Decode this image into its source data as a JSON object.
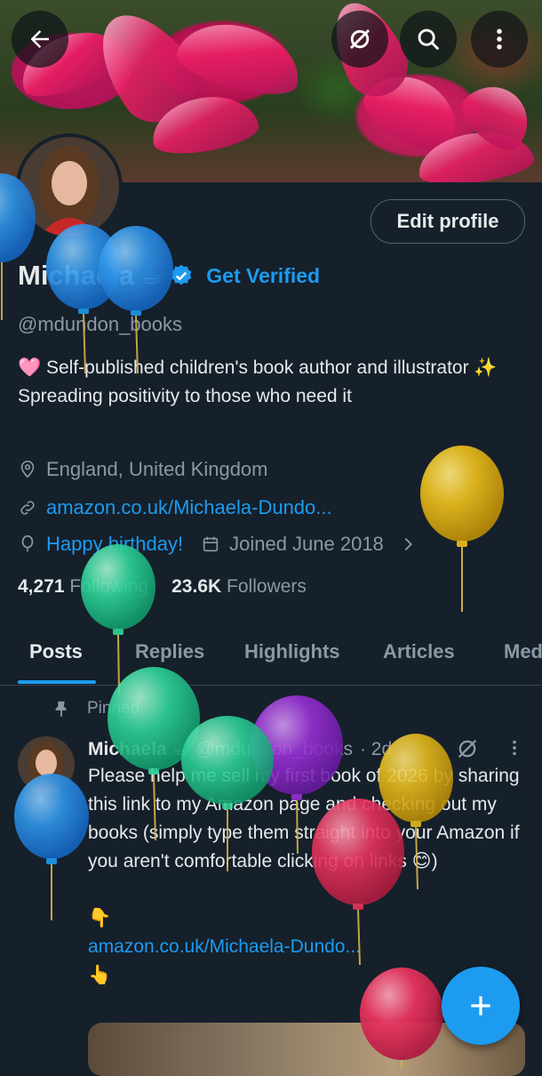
{
  "profile": {
    "name": "Michaela",
    "name_emoji": "☕",
    "get_verified": "Get Verified",
    "handle": "@mdundon_books",
    "edit_profile": "Edit profile",
    "bio": "🩷 Self-published children's book author and illustrator ✨ Spreading positivity to those who need it",
    "location": "England, United Kingdom",
    "website": "amazon.co.uk/Michaela-Dundo...",
    "birthday": "Happy birthday!",
    "joined": "Joined June 2018",
    "following_count": "4,271",
    "following_label": "Following",
    "followers_count": "23.6K",
    "followers_label": "Followers"
  },
  "tabs": [
    {
      "label": "Posts",
      "active": true
    },
    {
      "label": "Replies"
    },
    {
      "label": "Highlights"
    },
    {
      "label": "Articles"
    },
    {
      "label": "Med"
    }
  ],
  "pinned_post": {
    "pinned_label": "Pinned",
    "author": "Michaela ☕",
    "handle": "@mdundon_books",
    "time": "· 2d",
    "text": "Please help me sell my first book of 2026 by sharing this link to my Amazon page and checking out my books (simply type them straight into your Amazon if you aren't comfortable clicking on links 😊)",
    "pointer_down": "👇",
    "link": "amazon.co.uk/Michaela-Dundo...",
    "pointer_up": "👆"
  },
  "colors": {
    "background": "#15202b",
    "accent": "#1d9bf0",
    "muted": "#8b98a5",
    "balloon_blue": "#2f95e8",
    "balloon_green": "#2fd49a",
    "balloon_yellow": "#e4b91c",
    "balloon_purple": "#9b30d9",
    "balloon_pink": "#e8345e"
  },
  "icons": [
    "back-arrow-icon",
    "grok-icon",
    "search-icon",
    "more-vertical-icon",
    "verified-badge-icon",
    "location-icon",
    "link-icon",
    "birthday-balloon-icon",
    "calendar-icon",
    "chevron-right-icon",
    "pin-icon",
    "plus-icon"
  ]
}
